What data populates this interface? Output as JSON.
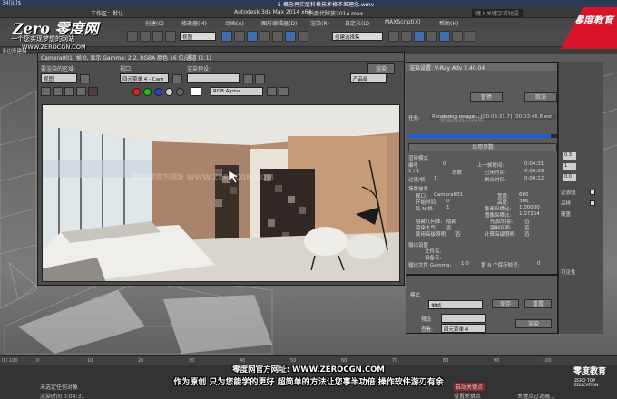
{
  "os_title": {
    "left": "34[JL]$",
    "center": "5-概念再实层科格技术格不差理念.wmv"
  },
  "max_title": {
    "workspace": "工作区：默认",
    "app": "Autodesk 3ds Max  2014 x64",
    "file": "后度代除放2014.max",
    "search_placeholder": "键入关键字或短语"
  },
  "menubar": [
    "创建(C)",
    "修改器(M)",
    "动画(A)",
    "图形编辑器(D)",
    "渲染(R)",
    "自定义(U)",
    "MAXScript(X)",
    "帮助(H)"
  ],
  "toolbar": {
    "view_select": "视图",
    "selection_set": "创建选择集"
  },
  "subbar": "多边形建模",
  "logo": {
    "brand": "Zero 零度网",
    "tagline": "一个您实现梦想的网站",
    "url": "WWW.ZEROCGN.COM"
  },
  "brand_corner": {
    "name": "零度教育",
    "url": "WWW.ZEROCGN.COM"
  },
  "render_window": {
    "title": "Camera001, 帧 0, 显示 Gamma: 2.2, RGBA 颜色 16 位/通道 (1:1)",
    "area_label": "要渲染的区域:",
    "area_value": "视图",
    "viewport_label": "视口:",
    "viewport_value": "四元菜单 4 - Cam",
    "preset_label": "渲染预设:",
    "preset_value": "",
    "render_button": "渲染",
    "mode_value": "产品级",
    "channel_value": "RGB Alpha",
    "watermark": "零度网官方网址  WWW.ZEROCGN.COM"
  },
  "vray_window": {
    "title": "渲染设置: V-Ray Adv 2.40.04",
    "pause_button": "暂停",
    "cancel_button": "取消",
    "task_label": "任务:",
    "task_value": "Rendering image... [00:03:31.7] [00:03:46.8 est]",
    "progress_fraction": 0.96,
    "common_params": "公用参数",
    "rows": [
      {
        "k": "渲染模式",
        "v": ""
      },
      {
        "k": "编号",
        "v": "0"
      },
      {
        "k": "上一帧时间:",
        "v": "0:04:31"
      },
      {
        "k": "1 / 1",
        "v": ""
      },
      {
        "k": "总数",
        "v": ""
      },
      {
        "k": "已用时间:",
        "v": "0:00:09"
      },
      {
        "k": "剩余时间:",
        "v": "0:00:12"
      },
      {
        "k": "过渡/帧:",
        "v": "1"
      }
    ],
    "scene_section": "场景信息",
    "camera_label": "视口:",
    "camera_value": "Camera001",
    "width_label": "宽度:",
    "width_value": "600",
    "height_label": "高度:",
    "height_value": "386",
    "start_frame_label": "开始时间:",
    "start_frame_value": "0",
    "pixel_aspect_label": "像素纵横比:",
    "pixel_aspect_value": "1.00000",
    "nth_frame_label": "每 N 帧:",
    "nth_frame_value": "1",
    "image_aspect_label": "图像纵横比:",
    "image_aspect_value": "1.07254",
    "hidden_geo_label": "隐藏几何体:",
    "hidden_geo_value": "隐藏",
    "render_atmo_label": "渲染大气:",
    "render_atmo_value": "否",
    "area_lights_label": "光源/阴影:",
    "area_lights_value": "否",
    "force_2side_label": "强制双面:",
    "force_2side_value": "否",
    "use_adv_label": "使用高级照明:",
    "use_adv_value": "否",
    "calc_adv_label": "计算高级照明:",
    "calc_adv_value": "否",
    "output_section": "输出设置",
    "file_name_label": "文件名:",
    "device_label": "设备名:",
    "output_file_label": "输出文件 Gamma:",
    "output_file_value": "1.0",
    "save_frame_label": "第 N 个保存帧号:",
    "save_frame_value": "0",
    "watermark": "零度网官方网址"
  },
  "right_panel": {
    "v1": "0.3",
    "v2": "1",
    "v3": "0.0",
    "lbl1": "过滤值",
    "lbl2": "采样",
    "lbl3": "覆盖",
    "lbl4": "可见性"
  },
  "lower_settings": {
    "mode_label": "模式",
    "mode_value": "单帧",
    "save_button": "保存",
    "copy_button": "重置",
    "preset_label": "预设:",
    "preset_value": "",
    "view_label": "查看:",
    "view_value": "四元菜单 4",
    "render_button": "渲染",
    "watermark": "零度网官方网址"
  },
  "timeline": {
    "position": "0 / 100",
    "ticks": [
      "0",
      "10",
      "20",
      "30",
      "40",
      "50",
      "60",
      "70",
      "80",
      "90",
      "100"
    ]
  },
  "status": {
    "selection": "未选定任何对象",
    "render_time": "渲染时间  0:04:31",
    "auto_key": "自动关键点",
    "set_key": "设置关键点",
    "key_filter": "关键点过滤器..."
  },
  "banner": {
    "line1": "零度网官方网址: WWW.ZEROCGN.COM",
    "line2": "作为原创  只为您能学的更好  超简单的方法让您事半功倍  操作软件游刃有余"
  },
  "corner_logo": {
    "name": "零度教育",
    "sub": "ZERO TOP EDUCATION"
  },
  "colors": {
    "accent_blue": "#1f5fd4",
    "brand_red": "#d8132a"
  }
}
